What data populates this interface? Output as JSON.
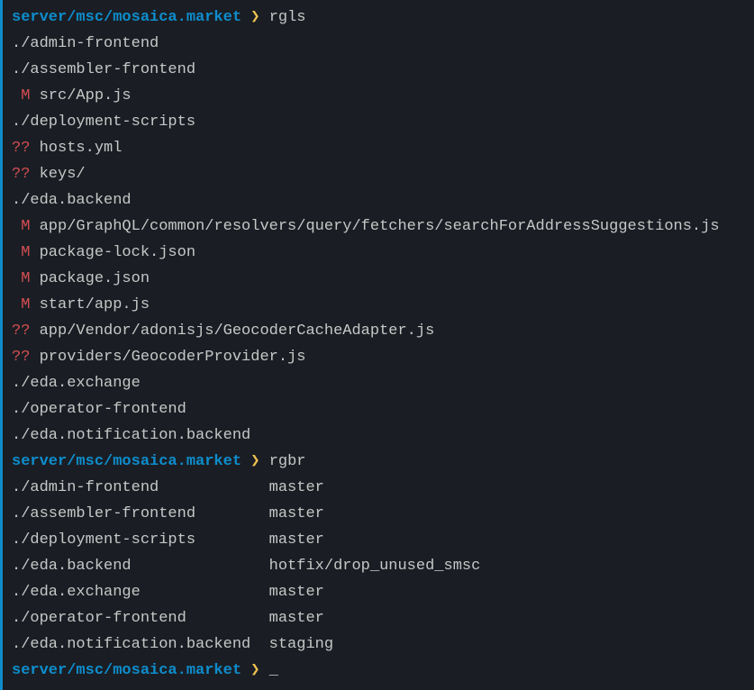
{
  "prompt": {
    "path": "server/msc/mosaica.market",
    "arrow": "❯"
  },
  "commands": {
    "cmd1": "rgls",
    "cmd2": "rgbr"
  },
  "rgls_output": [
    {
      "type": "dir",
      "text": "./admin-frontend"
    },
    {
      "type": "dir",
      "text": "./assembler-frontend"
    },
    {
      "type": "status",
      "status": " M ",
      "file": "src/App.js"
    },
    {
      "type": "dir",
      "text": "./deployment-scripts"
    },
    {
      "type": "untracked",
      "status": "?? ",
      "file": "hosts.yml"
    },
    {
      "type": "untracked",
      "status": "?? ",
      "file": "keys/"
    },
    {
      "type": "dir",
      "text": "./eda.backend"
    },
    {
      "type": "status",
      "status": " M ",
      "file": "app/GraphQL/common/resolvers/query/fetchers/searchForAddressSuggestions.js"
    },
    {
      "type": "status",
      "status": " M ",
      "file": "package-lock.json"
    },
    {
      "type": "status",
      "status": " M ",
      "file": "package.json"
    },
    {
      "type": "status",
      "status": " M ",
      "file": "start/app.js"
    },
    {
      "type": "untracked",
      "status": "?? ",
      "file": "app/Vendor/adonisjs/GeocoderCacheAdapter.js"
    },
    {
      "type": "untracked",
      "status": "?? ",
      "file": "providers/GeocoderProvider.js"
    },
    {
      "type": "dir",
      "text": "./eda.exchange"
    },
    {
      "type": "dir",
      "text": "./operator-frontend"
    },
    {
      "type": "dir",
      "text": "./eda.notification.backend"
    }
  ],
  "rgbr_output": [
    {
      "repo": "./admin-frontend",
      "branch": "master"
    },
    {
      "repo": "./assembler-frontend",
      "branch": "master"
    },
    {
      "repo": "./deployment-scripts",
      "branch": "master"
    },
    {
      "repo": "./eda.backend",
      "branch": "hotfix/drop_unused_smsc"
    },
    {
      "repo": "./eda.exchange",
      "branch": "master"
    },
    {
      "repo": "./operator-frontend",
      "branch": "master"
    },
    {
      "repo": "./eda.notification.backend",
      "branch": "staging"
    }
  ],
  "cursor": "_"
}
